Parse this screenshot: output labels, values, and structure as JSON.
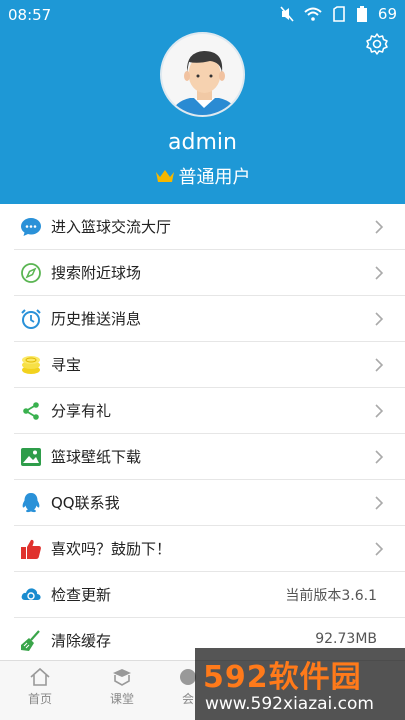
{
  "status_bar": {
    "time": "08:57",
    "battery": "69"
  },
  "profile": {
    "username": "admin",
    "role": "普通用户"
  },
  "menu": [
    {
      "label": "进入篮球交流大厅",
      "icon": "chat-bubble-icon"
    },
    {
      "label": "搜索附近球场",
      "icon": "compass-icon"
    },
    {
      "label": "历史推送消息",
      "icon": "alarm-clock-icon"
    },
    {
      "label": "寻宝",
      "icon": "coins-icon"
    },
    {
      "label": "分享有礼",
      "icon": "share-icon"
    },
    {
      "label": "篮球壁纸下载",
      "icon": "image-icon"
    },
    {
      "label": "QQ联系我",
      "icon": "qq-icon"
    },
    {
      "label": "喜欢吗？鼓励下！",
      "icon": "thumbs-up-icon"
    },
    {
      "label": "检查更新",
      "value": "当前版本3.6.1",
      "icon": "update-icon"
    },
    {
      "label": "清除缓存",
      "value": "92.73MB",
      "icon": "broom-icon"
    }
  ],
  "tabs": [
    {
      "label": "首页"
    },
    {
      "label": "课堂"
    },
    {
      "label": "会"
    }
  ],
  "watermark": {
    "brand": "592软件园",
    "url": "www.592xiazai.com"
  },
  "colors": {
    "header_bg": "#1e98d6",
    "crown": "#f5b700"
  }
}
